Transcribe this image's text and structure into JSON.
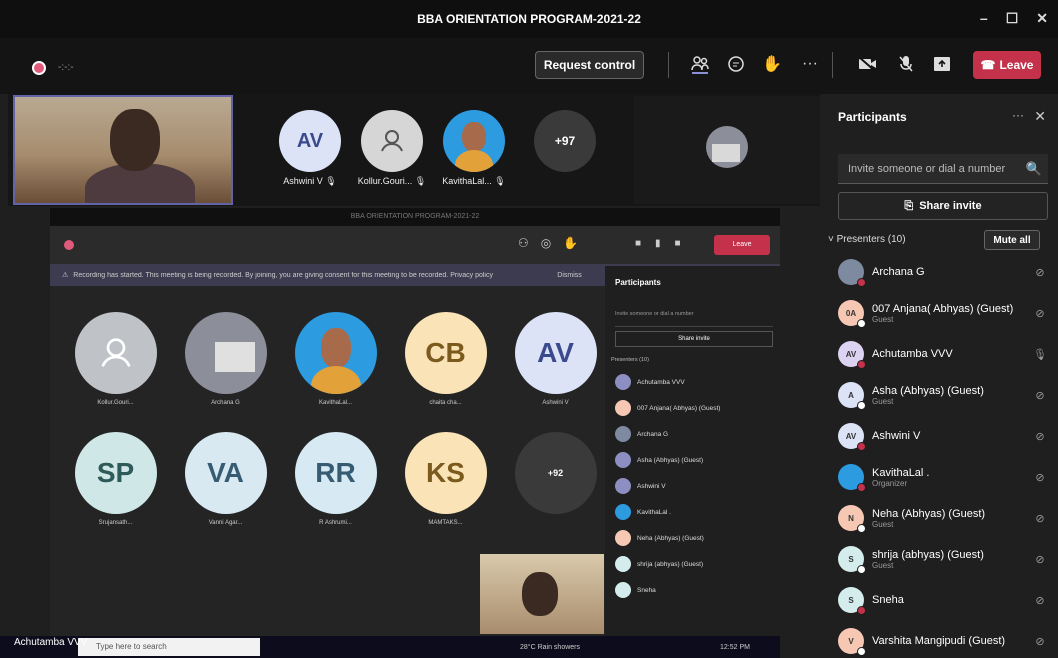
{
  "window": {
    "title": "BBA ORIENTATION PROGRAM-2021-22",
    "minimize": "–",
    "maximize": "☐",
    "close": "✕"
  },
  "toolbar": {
    "timer": "-:-:-",
    "request_control": "Request control",
    "leave": "Leave",
    "icons": [
      "people-icon",
      "chat-icon",
      "raise-hand-icon",
      "more-icon",
      "camera-icon",
      "mic-icon",
      "share-icon"
    ]
  },
  "strip": {
    "tiles": [
      {
        "initials": "AV",
        "name": "Ashwini V",
        "color": "#dde3f7",
        "text_color": "#3b4a8c"
      },
      {
        "initials": "",
        "name": "Kollur.Gouri...",
        "color": "#d6d6d6",
        "text_color": "#555"
      },
      {
        "initials": "",
        "name": "KavithaLal...",
        "color": "#2d9be0",
        "text_color": "#fff"
      },
      {
        "initials": "+97",
        "name": "",
        "color": "#3a3a3a",
        "text_color": "#fff"
      }
    ]
  },
  "inner": {
    "title": "BBA ORIENTATION PROGRAM-2021-22",
    "banner": "Recording has started. This meeting is being recorded. By joining, you are giving consent for this meeting to be recorded. Privacy policy",
    "banner_dismiss": "Dismiss",
    "leave": "Leave",
    "grid": [
      {
        "initials": "",
        "name": "Kollur.Gouri...",
        "color": "#bfc3c8"
      },
      {
        "initials": "",
        "name": "Archana G",
        "color": "#8c8f9a"
      },
      {
        "initials": "",
        "name": "KavithaLal...",
        "color": "#2d9be0"
      },
      {
        "initials": "CB",
        "name": "chaita cha...",
        "color": "#fbe3b8"
      },
      {
        "initials": "AV",
        "name": "Ashwini V",
        "color": "#dde3f7"
      },
      {
        "initials": "SP",
        "name": "Srujansath...",
        "color": "#cfe7e6"
      },
      {
        "initials": "VA",
        "name": "Vanni Agar...",
        "color": "#d9e9f2"
      },
      {
        "initials": "RR",
        "name": "R Ashrumi...",
        "color": "#d7e9f3"
      },
      {
        "initials": "KS",
        "name": "MAMTAKS...",
        "color": "#fbe3b8"
      },
      {
        "initials": "+92",
        "name": "",
        "color": "#3a3a3a"
      }
    ],
    "panel_title": "Participants",
    "panel_invite": "Invite someone or dial a number",
    "panel_share": "Share invite",
    "panel_presenters": "Presenters (10)",
    "panel_rows": [
      "Achutamba VVV",
      "007 Anjana( Abhyas) (Guest)",
      "Archana G",
      "Asha (Abhyas) (Guest)",
      "Ashwini V",
      "KavithaLal .",
      "Neha (Abhyas) (Guest)",
      "shrija (abhyas) (Guest)",
      "Sneha"
    ]
  },
  "taskbar": {
    "search_placeholder": "Type here to search",
    "self_label": "Achutamba VVV",
    "weather": "28°C Rain showers",
    "time": "12:52 PM"
  },
  "panel": {
    "title": "Participants",
    "invite_placeholder": "Invite someone or dial a number",
    "share_invite": "Share invite",
    "presenters": "Presenters (10)",
    "mute_all": "Mute all",
    "participants": [
      {
        "initials": "",
        "name": "Archana G",
        "sub": "",
        "color": "#7e8aa0",
        "dot": "#c4314b",
        "mic": "🎙̸"
      },
      {
        "initials": "0A",
        "name": "007 Anjana( Abhyas) (Guest)",
        "sub": "Guest",
        "color": "#f6c8b4",
        "dot": "#fff",
        "mic": "🎙̸"
      },
      {
        "initials": "AV",
        "name": "Achutamba VVV",
        "sub": "",
        "color": "#dcd2f2",
        "dot": "#c4314b",
        "mic": "🎙"
      },
      {
        "initials": "A",
        "name": "Asha (Abhyas) (Guest)",
        "sub": "Guest",
        "color": "#dde3f7",
        "dot": "#fff",
        "mic": "🎙̸"
      },
      {
        "initials": "AV",
        "name": "Ashwini V",
        "sub": "",
        "color": "#dde3f7",
        "dot": "#c4314b",
        "mic": "🎙̸"
      },
      {
        "initials": "",
        "name": "KavithaLal .",
        "sub": "Organizer",
        "color": "#2d9be0",
        "dot": "#c4314b",
        "mic": "🎙̸"
      },
      {
        "initials": "N",
        "name": "Neha (Abhyas) (Guest)",
        "sub": "Guest",
        "color": "#f6c8b4",
        "dot": "#fff",
        "mic": "🎙̸"
      },
      {
        "initials": "S",
        "name": "shrija (abhyas) (Guest)",
        "sub": "Guest",
        "color": "#d4ecec",
        "dot": "#fff",
        "mic": "🎙̸"
      },
      {
        "initials": "S",
        "name": "Sneha",
        "sub": "",
        "color": "#d4ecec",
        "dot": "#c4314b",
        "mic": "🎙̸"
      },
      {
        "initials": "V",
        "name": "Varshita Mangipudi (Guest)",
        "sub": "",
        "color": "#f6c8b4",
        "dot": "#fff",
        "mic": "🎙̸"
      }
    ]
  }
}
